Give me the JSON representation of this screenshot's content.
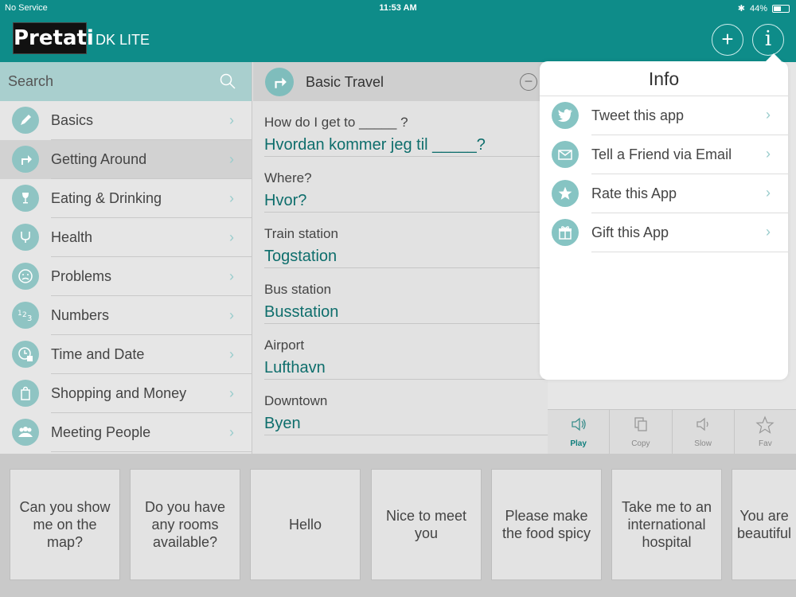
{
  "status": {
    "carrier": "No Service",
    "time": "11:53 AM",
    "battery": "44%"
  },
  "header": {
    "logo": "Pretati",
    "subtitle": "DK LITE",
    "add_label": "+",
    "info_label": "i"
  },
  "sidebar": {
    "search_placeholder": "Search",
    "items": [
      {
        "label": "Basics",
        "icon": "pen-icon"
      },
      {
        "label": "Getting Around",
        "icon": "turn-arrow-icon"
      },
      {
        "label": "Eating & Drinking",
        "icon": "wine-glass-icon"
      },
      {
        "label": "Health",
        "icon": "stethoscope-icon"
      },
      {
        "label": "Problems",
        "icon": "sad-face-icon"
      },
      {
        "label": "Numbers",
        "icon": "numbers-icon"
      },
      {
        "label": "Time and Date",
        "icon": "clock-icon"
      },
      {
        "label": "Shopping and Money",
        "icon": "bag-icon"
      },
      {
        "label": "Meeting People",
        "icon": "people-icon"
      }
    ]
  },
  "middle": {
    "title": "Basic Travel",
    "phrases": [
      {
        "en": "How do I get to _____ ?",
        "dk": "Hvordan kommer jeg til _____?"
      },
      {
        "en": "Where?",
        "dk": "Hvor?"
      },
      {
        "en": "Train station",
        "dk": "Togstation"
      },
      {
        "en": "Bus station",
        "dk": "Busstation"
      },
      {
        "en": "Airport",
        "dk": "Lufthavn"
      },
      {
        "en": "Downtown",
        "dk": "Byen"
      }
    ]
  },
  "actions": [
    "Play",
    "Copy",
    "Slow",
    "Fav"
  ],
  "popover": {
    "title": "Info",
    "items": [
      {
        "label": "Tweet this app",
        "icon": "twitter-icon"
      },
      {
        "label": "Tell a Friend via Email",
        "icon": "email-icon"
      },
      {
        "label": "Rate this App",
        "icon": "star-icon"
      },
      {
        "label": "Gift this App",
        "icon": "gift-icon"
      }
    ]
  },
  "cards": [
    "Can you show me on the map?",
    "Do you have any rooms available?",
    "Hello",
    "Nice to meet you",
    "Please make the food spicy",
    "Take me to an international hospital",
    "You are beautiful"
  ]
}
